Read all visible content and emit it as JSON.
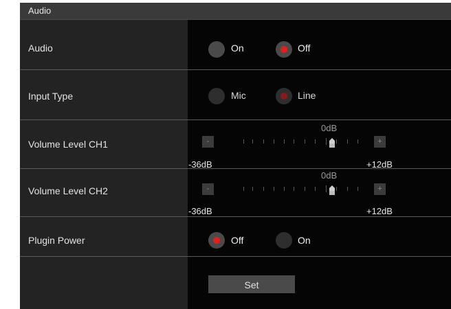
{
  "header": {
    "title": "Audio"
  },
  "rows": {
    "audio": {
      "label": "Audio",
      "opt1": "On",
      "opt2": "Off",
      "selected": "Off"
    },
    "input_type": {
      "label": "Input Type",
      "opt1": "Mic",
      "opt2": "Line",
      "selected": "Line"
    },
    "vol_ch1": {
      "label": "Volume Level CH1",
      "center": "0dB",
      "min": "-36dB",
      "max": "+12dB",
      "minus": "-",
      "plus": "+",
      "value_db": 0
    },
    "vol_ch2": {
      "label": "Volume Level CH2",
      "center": "0dB",
      "min": "-36dB",
      "max": "+12dB",
      "minus": "-",
      "plus": "+",
      "value_db": 0
    },
    "plugin_power": {
      "label": "Plugin Power",
      "opt1": "Off",
      "opt2": "On",
      "selected": "Off"
    }
  },
  "set_button": "Set",
  "colors": {
    "accent": "#e02020",
    "panel": "#1a1a1a",
    "right_bg": "#050505"
  }
}
